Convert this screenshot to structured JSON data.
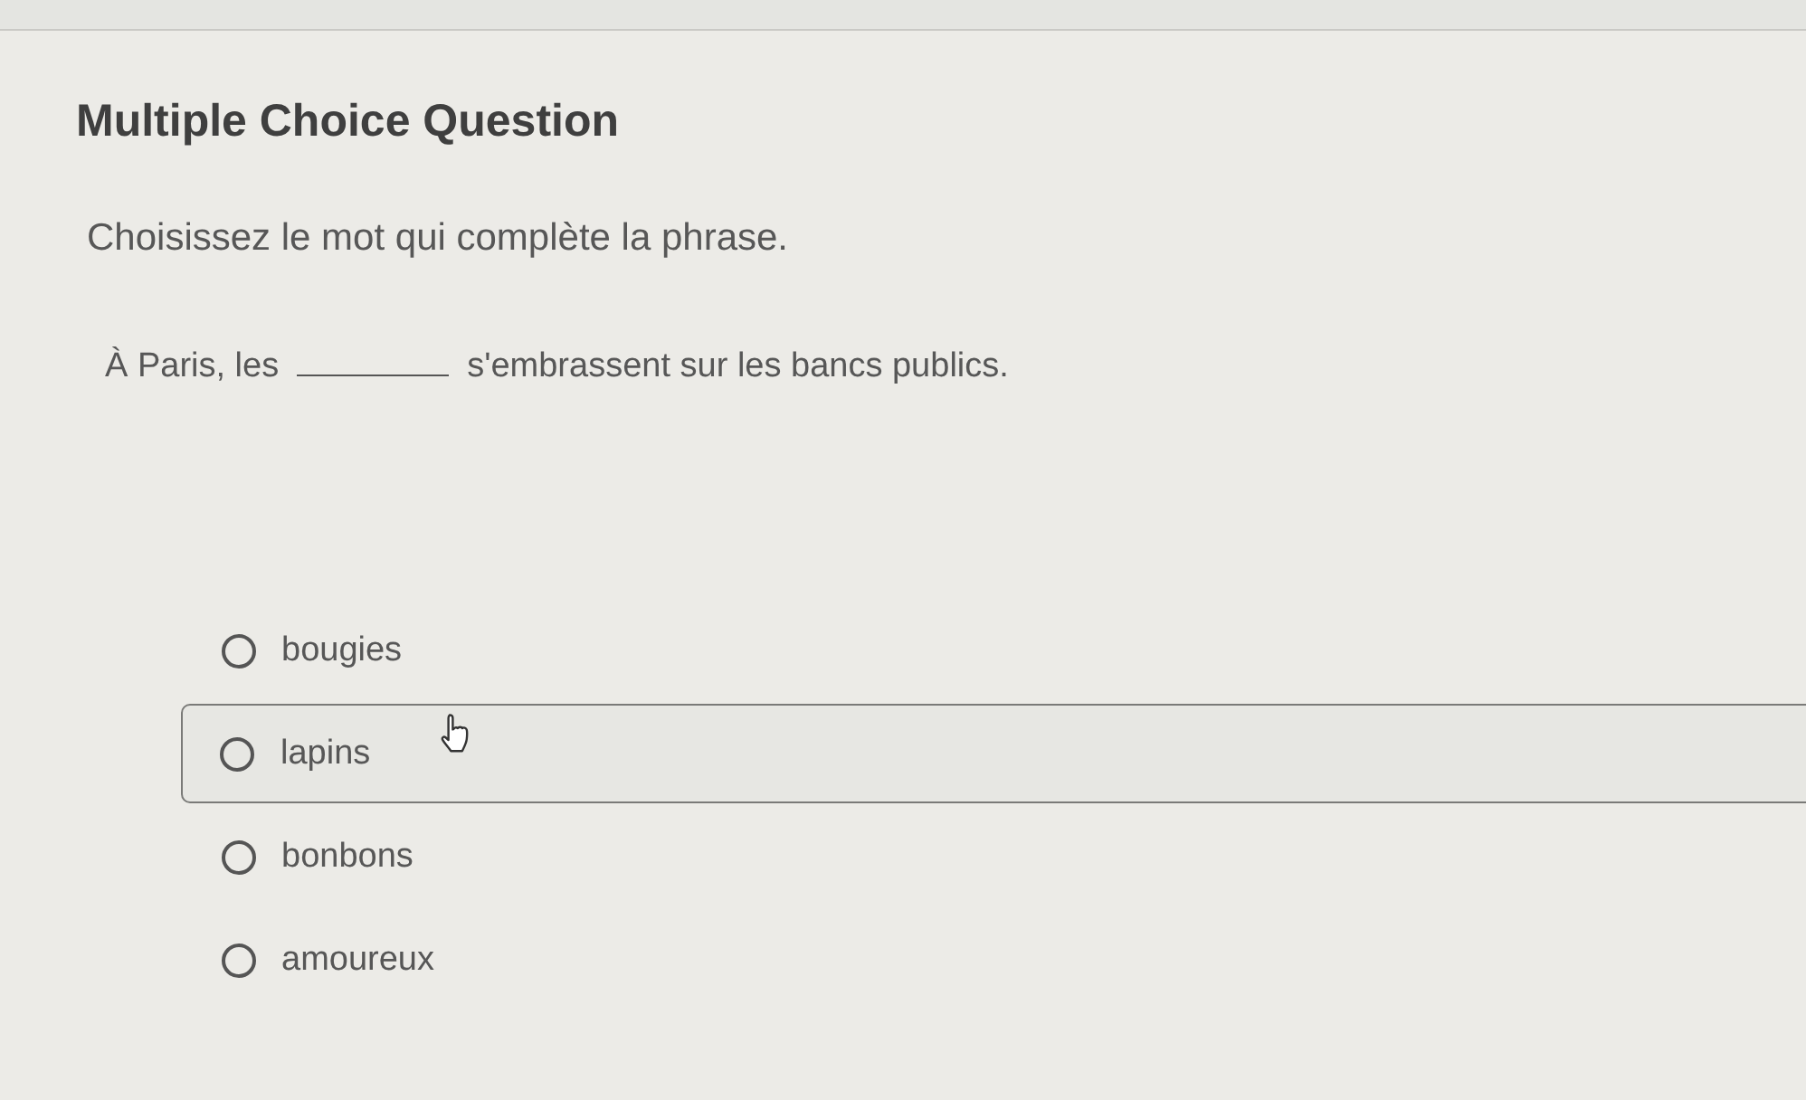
{
  "question": {
    "type_label": "Multiple Choice Question",
    "instruction": "Choisissez le mot qui complète la phrase.",
    "sentence": {
      "before": "À Paris, les",
      "after": "s'embrassent sur les bancs publics."
    }
  },
  "options": [
    {
      "label": "bougies",
      "selected": false,
      "hovered": false
    },
    {
      "label": "lapins",
      "selected": false,
      "hovered": true
    },
    {
      "label": "bonbons",
      "selected": false,
      "hovered": false
    },
    {
      "label": "amoureux",
      "selected": false,
      "hovered": false
    }
  ]
}
